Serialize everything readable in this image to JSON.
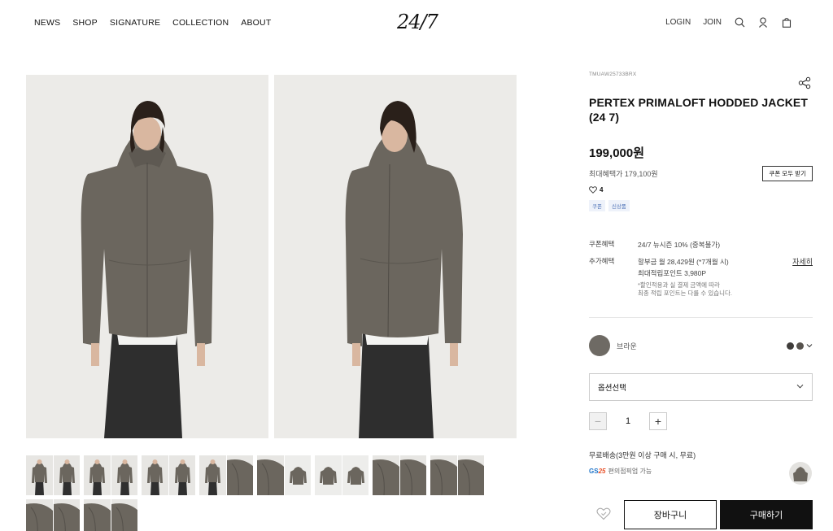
{
  "header": {
    "nav": [
      "NEWS",
      "SHOP",
      "SIGNATURE",
      "COLLECTION",
      "ABOUT"
    ],
    "logo": "24/7",
    "login": "LOGIN",
    "join": "JOIN"
  },
  "icons": {
    "search": "search-icon",
    "account": "user-icon",
    "cart": "bag-icon",
    "share": "share-icon",
    "heart": "heart-icon",
    "chevron": "chevron-down-icon"
  },
  "product": {
    "sku": "TMUAW25733BRX",
    "title": "PERTEX PRIMALOFT HODDED JACKET (24 7)",
    "price": "199,000원",
    "max_benefit": "최대혜택가 179,100원",
    "coupon_all_label": "쿠폰 모두 받기",
    "likes": "4",
    "badges": [
      "쿠폰",
      "신상품"
    ]
  },
  "benefits": {
    "coupon_label": "쿠폰혜택",
    "coupon_value": "24/7 뉴시즌 10% (중복불가)",
    "extra_label": "추가혜택",
    "installment": "할부금 월 28,429원 (*7개월 시)",
    "points": "최대적립포인트 3,980P",
    "more_label": "자세히",
    "note_line1": "*할인적용과 실 결제 금액에 따라",
    "note_line2": "최종 적립 포인트는 다를 수 있습니다."
  },
  "option": {
    "color_name": "브라운",
    "select_placeholder": "옵션선택",
    "quantity": "1",
    "minus": "−",
    "plus": "+"
  },
  "shipping": {
    "free": "무료배송(3만원 이상 구매 시, 무료)",
    "gs_prefix": "GS",
    "gs_num": "25",
    "gs_text": "편의점픽업 가능"
  },
  "actions": {
    "cart": "장바구니",
    "buy": "구매하기"
  },
  "colors": {
    "jacket": "#6b665e",
    "pants": "#2f2f2f",
    "bg": "#ecebe8",
    "thumb_selected": "#e98a2d"
  }
}
